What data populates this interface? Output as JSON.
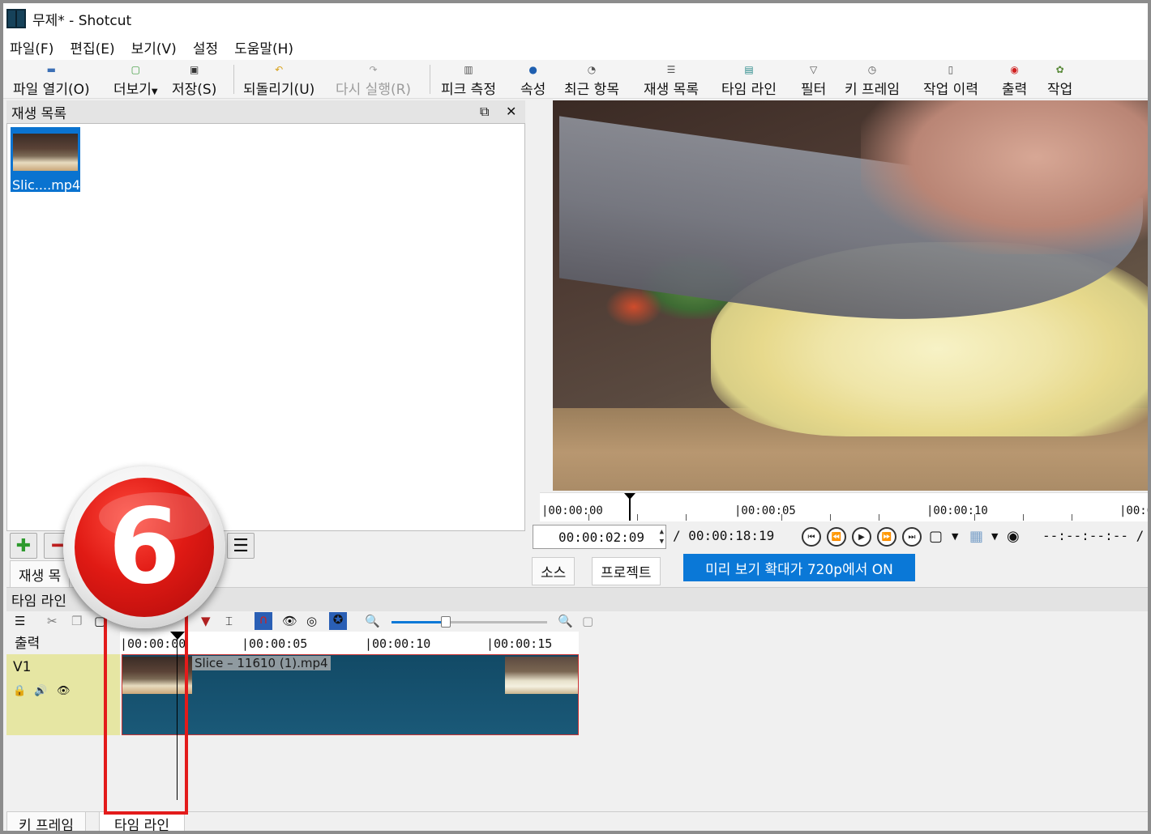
{
  "window": {
    "title": "무제* - Shotcut"
  },
  "menu": [
    "파일(F)",
    "편집(E)",
    "보기(V)",
    "설정",
    "도움말(H)"
  ],
  "toolbar": [
    {
      "label": "파일 열기(O)",
      "icon": "folder-open-icon",
      "enabled": true
    },
    {
      "label": "더보기",
      "icon": "more-icon",
      "enabled": true
    },
    {
      "label": "저장(S)",
      "icon": "save-icon",
      "enabled": true
    },
    {
      "label": "되돌리기(U)",
      "icon": "undo-icon",
      "enabled": true
    },
    {
      "label": "다시 실행(R)",
      "icon": "redo-icon",
      "enabled": false
    },
    {
      "label": "피크 측정",
      "icon": "peak-meter-icon",
      "enabled": true
    },
    {
      "label": "속성",
      "icon": "info-icon",
      "enabled": true
    },
    {
      "label": "최근 항목",
      "icon": "recent-icon",
      "enabled": true
    },
    {
      "label": "재생 목록",
      "icon": "playlist-icon",
      "enabled": true
    },
    {
      "label": "타임 라인",
      "icon": "timeline-icon",
      "enabled": true
    },
    {
      "label": "필터",
      "icon": "filter-icon",
      "enabled": true
    },
    {
      "label": "키 프레임",
      "icon": "keyframe-icon",
      "enabled": true
    },
    {
      "label": "작업 이력",
      "icon": "history-icon",
      "enabled": true
    },
    {
      "label": "출력",
      "icon": "export-icon",
      "enabled": true
    },
    {
      "label": "작업",
      "icon": "jobs-icon",
      "enabled": true
    }
  ],
  "playlist": {
    "title": "재생 목록",
    "items": [
      {
        "label": "Slic....mp4"
      }
    ],
    "tabs": [
      "재생 목"
    ]
  },
  "player": {
    "ruler": [
      "|00:00:00",
      "|00:00:05",
      "|00:00:10",
      "|00:00:"
    ],
    "position": "00:00:02:09",
    "duration": "/ 00:00:18:19",
    "end_timecode": "--:--:--:-- /",
    "tabs": [
      "소스",
      "프로젝트"
    ],
    "preview_notice": "미리 보기 확대가 720p에서 ON"
  },
  "timeline": {
    "title": "타임 라인",
    "output_label": "출력",
    "track_label": "V1",
    "ruler": [
      "|00:00:00",
      "|00:00:05",
      "|00:00:10",
      "|00:00:15"
    ],
    "clip_label": "Slice – 11610 (1).mp4",
    "zoom_level": 0.35
  },
  "bottom_tabs": [
    "키 프레임",
    "타임 라인"
  ],
  "callout": {
    "number": "6",
    "color": "#e31b1b"
  }
}
